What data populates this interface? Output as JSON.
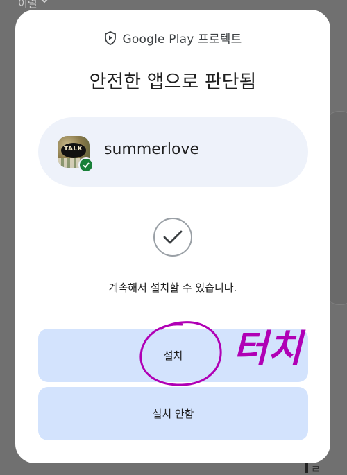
{
  "background": {
    "top_text": "이럴",
    "bottom_text": "ㄹ"
  },
  "dialog": {
    "protect_label": "Google Play 프로텍트",
    "title": "안전한 앱으로 판단됨",
    "app_name": "summerlove",
    "app_icon_text": "TALK",
    "message": "계속해서 설치할 수 있습니다.",
    "install_label": "설치",
    "dont_install_label": "설치 안함"
  },
  "annotation": {
    "handwritten_text": "터치",
    "color": "#b000b5"
  },
  "colors": {
    "dialog_bg": "#ffffff",
    "card_bg": "#eef2fa",
    "button_bg": "#d3e3fd",
    "verified_green": "#188038",
    "scrim": "#707070"
  }
}
